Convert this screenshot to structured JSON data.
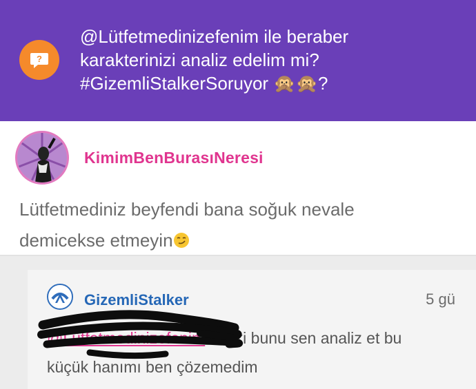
{
  "question": {
    "icon": "question-bubble-icon",
    "line1": "@Lütfetmedinizefenim ile beraber",
    "line2": "karakterinizi analiz edelim mi?",
    "line3": "#GizemliStalkerSoruyor 🙊🙊?"
  },
  "answer": {
    "username": "KimimBenBurasıNeresi",
    "text_line1": "Lütfetmediniz beyfendi bana soğuk nevale",
    "text_line2": "demicekse etmeyin",
    "emoji": "smirk-emoji-icon"
  },
  "comment": {
    "username": "GizemliStalker",
    "time": "5 gü",
    "mention": "@Lütfetmedinizefenim",
    "text_line1": "kanki bunu sen analiz et bu",
    "text_line2": "küçük hanımı ben çözemedim"
  },
  "colors": {
    "header_bg": "#6a3fb8",
    "badge": "#f58a2b",
    "username_pink": "#e0358f",
    "username_blue": "#2567b6"
  }
}
